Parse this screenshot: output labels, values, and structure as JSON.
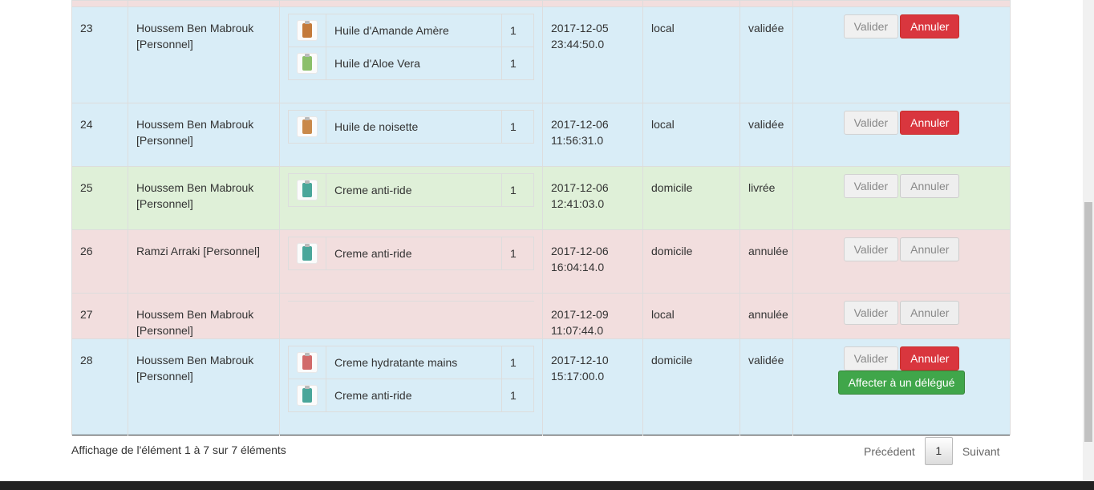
{
  "orders": [
    {
      "id": "23",
      "client": "Houssem Ben Mabrouk [Personnel]",
      "products": [
        {
          "name": "Huile d'Amande Amère",
          "qty": "1",
          "icon": "oil-bottle-icon",
          "color": "#c47a3a"
        },
        {
          "name": "Huile d'Aloe Vera",
          "qty": "1",
          "icon": "aloe-bottle-icon",
          "color": "#8bbf6a"
        }
      ],
      "date": "2017-12-05",
      "time": "23:44:50.0",
      "mode": "local",
      "status": "validée",
      "validate_label": "Valider",
      "cancel_label": "Annuler"
    },
    {
      "id": "24",
      "client": "Houssem Ben Mabrouk [Personnel]",
      "products": [
        {
          "name": "Huile de noisette",
          "qty": "1",
          "icon": "oil-bottle-icon",
          "color": "#c9894a"
        }
      ],
      "date": "2017-12-06",
      "time": "11:56:31.0",
      "mode": "local",
      "status": "validée",
      "validate_label": "Valider",
      "cancel_label": "Annuler"
    },
    {
      "id": "25",
      "client": "Houssem Ben Mabrouk [Personnel]",
      "products": [
        {
          "name": "Creme anti-ride",
          "qty": "1",
          "icon": "cream-jar-icon",
          "color": "#4aa69a"
        }
      ],
      "date": "2017-12-06",
      "time": "12:41:03.0",
      "mode": "domicile",
      "status": "livrée",
      "validate_label": "Valider",
      "cancel_label": "Annuler"
    },
    {
      "id": "26",
      "client": "Ramzi Arraki [Personnel]",
      "products": [
        {
          "name": "Creme anti-ride",
          "qty": "1",
          "icon": "cream-jar-icon",
          "color": "#4aa69a"
        }
      ],
      "date": "2017-12-06",
      "time": "16:04:14.0",
      "mode": "domicile",
      "status": "annulée",
      "validate_label": "Valider",
      "cancel_label": "Annuler"
    },
    {
      "id": "27",
      "client": "Houssem Ben Mabrouk [Personnel]",
      "products": [],
      "date": "2017-12-09",
      "time": "11:07:44.0",
      "mode": "local",
      "status": "annulée",
      "validate_label": "Valider",
      "cancel_label": "Annuler"
    },
    {
      "id": "28",
      "client": "Houssem Ben Mabrouk [Personnel]",
      "products": [
        {
          "name": "Creme hydratante mains",
          "qty": "1",
          "icon": "cream-jar-icon",
          "color": "#d16a6a"
        },
        {
          "name": "Creme anti-ride",
          "qty": "1",
          "icon": "cream-jar-icon",
          "color": "#4aa69a"
        }
      ],
      "date": "2017-12-10",
      "time": "15:17:00.0",
      "mode": "domicile",
      "status": "validée",
      "validate_label": "Valider",
      "cancel_label": "Annuler",
      "delegate_label": "Affecter à un délégué"
    }
  ],
  "footer": {
    "info": "Affichage de l'élément 1 à 7 sur 7 éléments",
    "prev_label": "Précédent",
    "current_page": "1",
    "next_label": "Suivant"
  },
  "colors": {
    "row_info": "#d9edf7",
    "row_success": "#dff0d8",
    "row_danger": "#f2dede",
    "btn_danger": "#d9363e",
    "btn_success": "#40a64a"
  }
}
